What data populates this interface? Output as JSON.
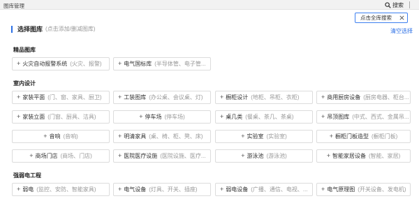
{
  "app": {
    "title": "图库管理"
  },
  "search": {
    "label": "搜索"
  },
  "tooltip": {
    "text": "点击全库搜索"
  },
  "section": {
    "title": "选择图库",
    "hint": "(点击添加/删减图库)",
    "clear_label": "清空选择"
  },
  "groups": [
    {
      "title": "精品图库"
    },
    {
      "title": "室内设计"
    },
    {
      "title": "强弱电工程"
    }
  ],
  "tiles": [
    {
      "name": "火灾自动报警系统",
      "desc": "(火灾、报警)"
    },
    {
      "name": "电气国标库",
      "desc": "(半导体管、电子管..."
    },
    {
      "name": "家装平面",
      "desc": "(门、窗、家具、厨卫)"
    },
    {
      "name": "工装图库",
      "desc": "(办公桌、会议桌、灯)"
    },
    {
      "name": "橱柜设计",
      "desc": "(地柜、吊柜、衣柜)"
    },
    {
      "name": "商用厨房设备",
      "desc": "(厨房电器、柜台..."
    },
    {
      "name": "家装立面",
      "desc": "(门窗、厨具、洁具)"
    },
    {
      "name": "停车场",
      "desc": "(停车场)"
    },
    {
      "name": "桌几类",
      "desc": "(餐桌、茶几、茶桌)"
    },
    {
      "name": "吊顶图库",
      "desc": "(中式、西式、金属吊..."
    },
    {
      "name": "音响",
      "desc": "(音响)"
    },
    {
      "name": "明清家具",
      "desc": "(桌、椅、柜、凳、床)"
    },
    {
      "name": "实验室",
      "desc": "(实验室)"
    },
    {
      "name": "橱柜门板造型",
      "desc": "(橱柜门板)"
    },
    {
      "name": "商场门店",
      "desc": "(商场、门店)"
    },
    {
      "name": "医院医疗设施",
      "desc": "(医院设施、医疗..."
    },
    {
      "name": "游泳池",
      "desc": "(游泳池)"
    },
    {
      "name": "智能家居设备",
      "desc": "(智能、家居)"
    },
    {
      "name": "弱电",
      "desc": "(监控、安防、智能家具)"
    },
    {
      "name": "电气设备",
      "desc": "(灯具、开关、插座)"
    },
    {
      "name": "弱电设备",
      "desc": "(广播、通信、电视、..."
    },
    {
      "name": "电气原理图",
      "desc": "(开关设备、发电机)"
    }
  ]
}
